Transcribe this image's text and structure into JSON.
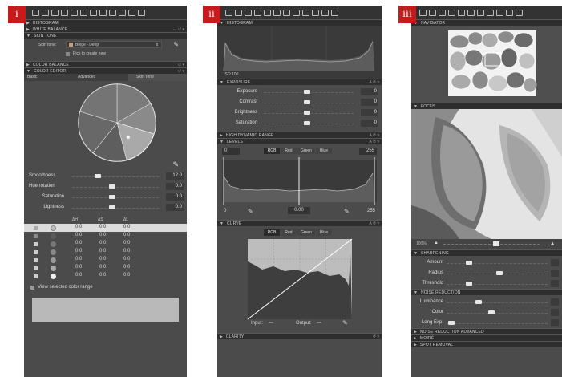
{
  "badges": [
    "i",
    "ii",
    "iii"
  ],
  "panel1": {
    "sections": {
      "histogram": "HISTOGRAM",
      "white_balance": "WHITE BALANCE",
      "skin_tone": "SKIN TONE",
      "color_balance": "COLOR BALANCE",
      "color_editor": "COLOR EDITOR"
    },
    "skin_tone_label": "Skin tone:",
    "skin_tone_value": "Beige - Deep",
    "pick_label": "Pick to create new",
    "tabs": [
      "Basic",
      "Advanced",
      "Skin Tone"
    ],
    "sliders": [
      {
        "label": "Smoothness",
        "value": "12.0",
        "level": 0.45
      },
      {
        "label": "Hue rotation",
        "value": "0.0",
        "level": 0.5
      },
      {
        "label": "Saturation",
        "value": "0.0",
        "level": 0.5
      },
      {
        "label": "Lightness",
        "value": "0.0",
        "level": 0.5
      }
    ],
    "table_headers": [
      "ΔH",
      "ΔS",
      "ΔL"
    ],
    "table_rows": [
      [
        "0.0",
        "0.0",
        "0.0"
      ],
      [
        "0.0",
        "0.0",
        "0.0"
      ],
      [
        "0.0",
        "0.0",
        "0.0"
      ],
      [
        "0.0",
        "0.0",
        "0.0"
      ],
      [
        "0.0",
        "0.0",
        "0.0"
      ],
      [
        "0.0",
        "0.0",
        "0.0"
      ],
      [
        "0.0",
        "0.0",
        "0.0"
      ]
    ],
    "view_range_label": "View selected color range"
  },
  "panel2": {
    "sections": {
      "histogram": "HISTOGRAM",
      "exposure": "EXPOSURE",
      "hdr": "HIGH DYNAMIC RANGE",
      "levels": "LEVELS",
      "curve": "CURVE",
      "clarity": "CLARITY"
    },
    "iso": "ISO 100",
    "sliders": [
      {
        "label": "Exposure",
        "value": "0",
        "level": 0.5
      },
      {
        "label": "Contrast",
        "value": "0",
        "level": 0.5
      },
      {
        "label": "Brightness",
        "value": "0",
        "level": 0.5
      },
      {
        "label": "Saturation",
        "value": "0",
        "level": 0.5
      }
    ],
    "level_tabs": [
      "RGB",
      "Red",
      "Green",
      "Blue"
    ],
    "levels_low": "0",
    "levels_high": "255",
    "levels_mid": "0.00",
    "levels_out_low": "0",
    "levels_out_high": "255",
    "curve_tabs": [
      "RGB",
      "Red",
      "Green",
      "Blue"
    ],
    "input_label": "Input:",
    "input_value": "—",
    "output_label": "Output:",
    "output_value": "—"
  },
  "panel3": {
    "sections": {
      "navigator": "NAVIGATOR",
      "focus": "FOCUS",
      "sharpening": "SHARPENING",
      "noise_reduction": "NOISE REDUCTION",
      "noise_reduction_adv": "NOISE REDUCTION ADVANCED",
      "moire": "MOIRÉ",
      "spot_removal": "SPOT REMOVAL"
    },
    "zoom_label": "100%",
    "sharpening_sliders": [
      {
        "label": "Amount",
        "level": 0.2
      },
      {
        "label": "Radius",
        "level": 0.55
      },
      {
        "label": "Threshold",
        "level": 0.2
      }
    ],
    "noise_sliders": [
      {
        "label": "Luminance",
        "level": 0.25
      },
      {
        "label": "Color",
        "level": 0.5
      },
      {
        "label": "Long Exp.",
        "level": 0.08
      }
    ]
  },
  "colors": {
    "panel": "#4b4b4b",
    "header": "#2e2e2e",
    "badge": "#c8191b",
    "toolbar": "#333333"
  }
}
